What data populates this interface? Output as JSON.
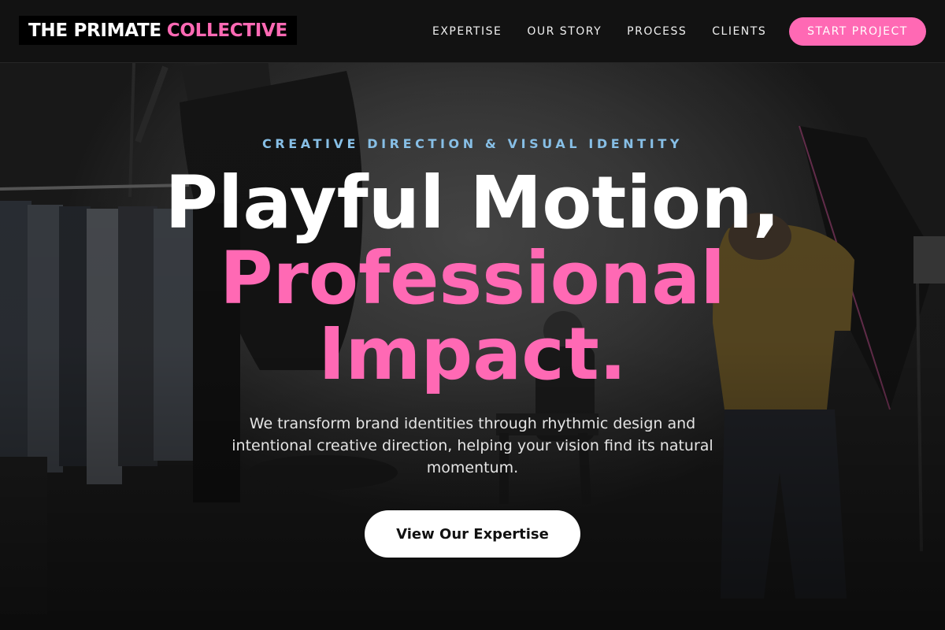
{
  "brand": {
    "name_main": "THE PRIMATE",
    "name_accent": "COLLECTIVE",
    "accent_color": "#ff69b4"
  },
  "nav": {
    "links": [
      {
        "label": "EXPERTISE"
      },
      {
        "label": "OUR STORY"
      },
      {
        "label": "PROCESS"
      },
      {
        "label": "CLIENTS"
      }
    ],
    "cta_label": "START PROJECT"
  },
  "hero": {
    "eyebrow": "CREATIVE DIRECTION & VISUAL IDENTITY",
    "headline_line1": "Playful Motion,",
    "headline_line2": "Professional",
    "headline_line3": "Impact.",
    "subtitle": "We transform brand identities through rhythmic design and intentional creative direction, helping your vision find its natural momentum.",
    "button_label": "View Our Expertise",
    "eyebrow_color": "#87bfe6",
    "background_image": "photo-studio-shoot"
  }
}
